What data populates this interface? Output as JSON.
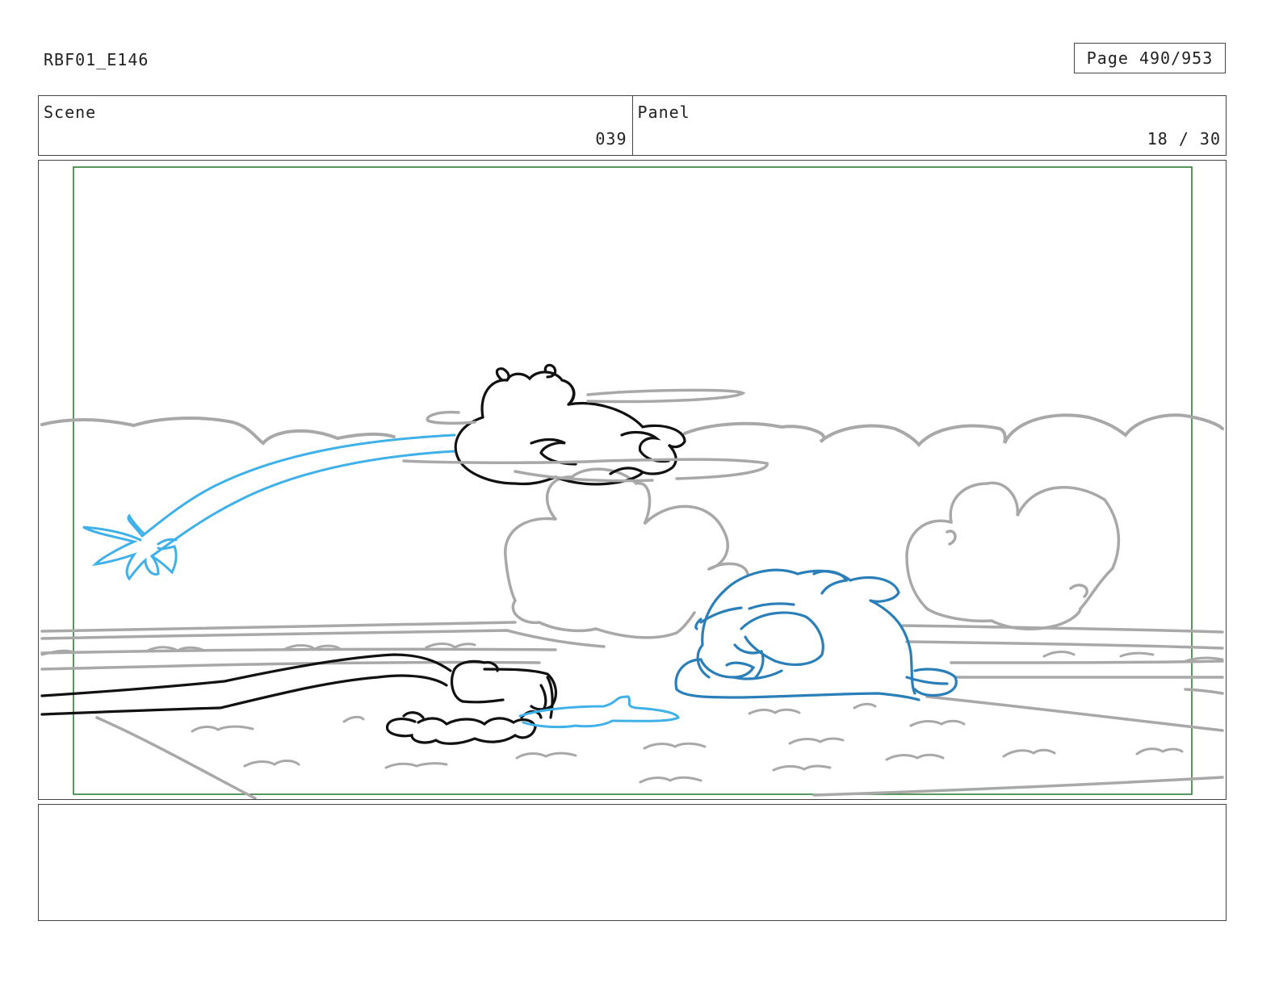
{
  "header": {
    "doc_id": "RBF01_E146",
    "page_label": "Page 490/953"
  },
  "scene": {
    "label": "Scene",
    "value": "039"
  },
  "panel": {
    "label": "Panel",
    "value": "18 / 30"
  },
  "notes": {
    "text": ""
  },
  "colors": {
    "sketch_gray": "#a8a8a8",
    "sketch_black": "#111111",
    "water_blue": "#3fb0e8",
    "character_blue": "#2a7fb8",
    "safe_frame_green": "#2e7d32"
  }
}
